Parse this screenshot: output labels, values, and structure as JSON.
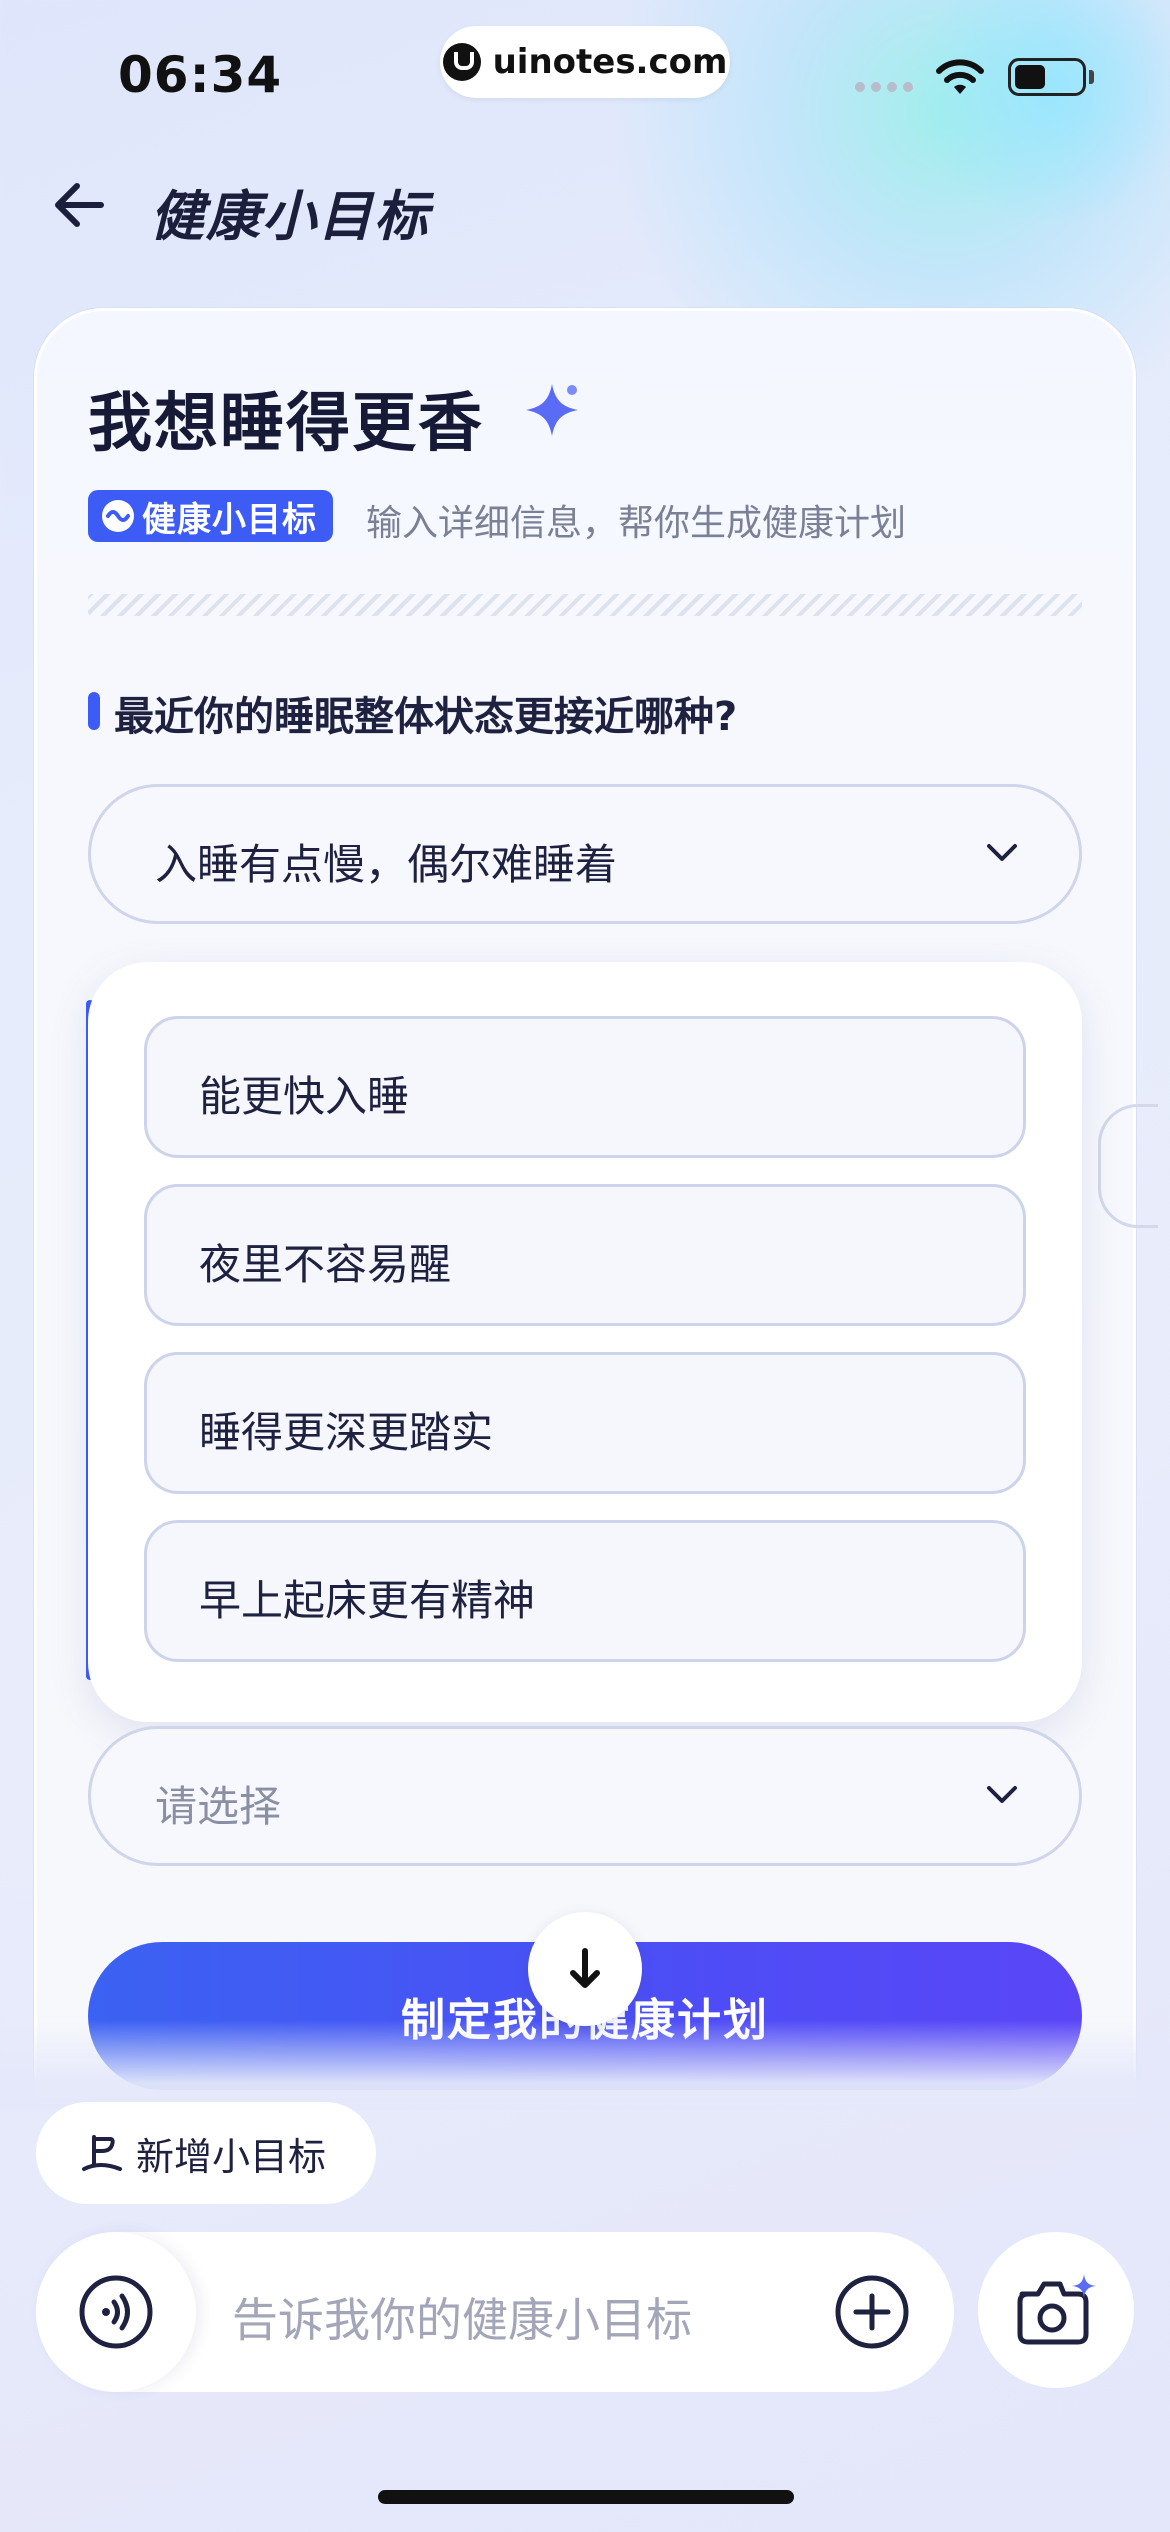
{
  "status_bar": {
    "time": "06:34",
    "url": "uinotes.com"
  },
  "nav": {
    "title": "健康小目标",
    "back_icon": "arrow-left-icon"
  },
  "card": {
    "title": "我想睡得更香",
    "badge": "健康小目标",
    "description": "输入详细信息，帮你生成健康计划",
    "question": "最近你的睡眠整体状态更接近哪种?",
    "select_value": "入睡有点慢，偶尔难睡着",
    "second_select_placeholder": "请选择"
  },
  "dropdown": {
    "options": [
      {
        "label": "能更快入睡"
      },
      {
        "label": "夜里不容易醒"
      },
      {
        "label": "睡得更深更踏实"
      },
      {
        "label": "早上起床更有精神"
      }
    ]
  },
  "actions": {
    "submit_label": "制定我的健康计划",
    "new_goal_label": "新增小目标"
  },
  "input": {
    "placeholder": "告诉我你的健康小目标"
  },
  "colors": {
    "accent": "#3c5cf5",
    "text_dark": "#1b1f3b",
    "text_muted": "#7a8096"
  }
}
